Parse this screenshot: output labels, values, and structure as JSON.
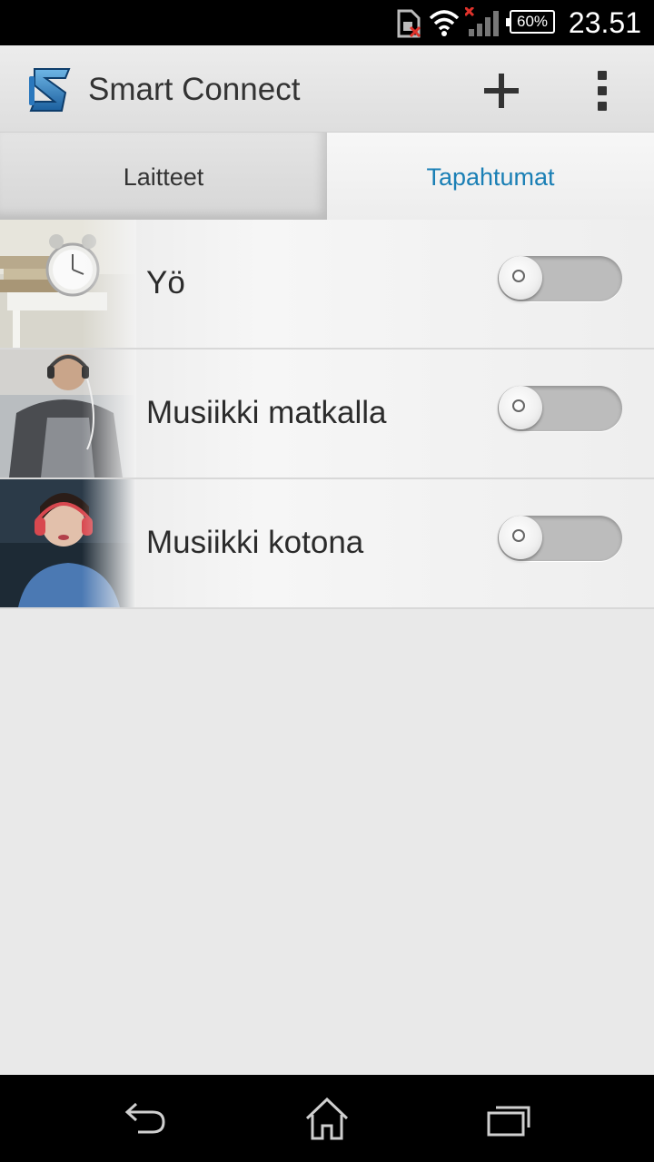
{
  "status_bar": {
    "time": "23.51",
    "battery": "60%",
    "icons": [
      "sim-missing-icon",
      "wifi-icon",
      "signal-no-service-icon",
      "battery-icon"
    ]
  },
  "action_bar": {
    "title": "Smart Connect",
    "logo_icon": "smart-connect-logo",
    "actions": [
      "add-icon",
      "overflow-menu-icon"
    ]
  },
  "tabs": [
    {
      "label": "Laitteet",
      "selected": false
    },
    {
      "label": "Tapahtumat",
      "selected": true
    }
  ],
  "events": [
    {
      "label": "Yö",
      "enabled": false,
      "thumbnail": "alarm-clock-books-image"
    },
    {
      "label": "Musiikki matkalla",
      "enabled": false,
      "thumbnail": "man-headphones-image"
    },
    {
      "label": "Musiikki kotona",
      "enabled": false,
      "thumbnail": "woman-headphones-sofa-image"
    }
  ],
  "nav_bar": {
    "buttons": [
      "back-icon",
      "home-icon",
      "recent-apps-icon"
    ]
  },
  "colors": {
    "accent": "#1a7fb5",
    "toggle_off": "#bcbcbc"
  }
}
